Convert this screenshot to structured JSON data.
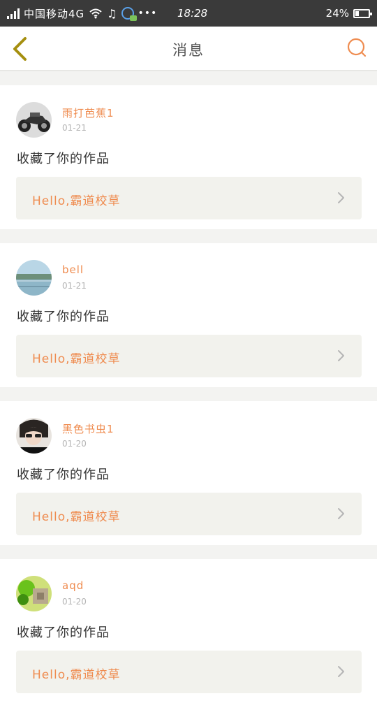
{
  "status_bar": {
    "carrier": "中国移动4G",
    "time": "18:28",
    "battery": "24%",
    "dots": "•••"
  },
  "header": {
    "title": "消息",
    "back_icon": "chevron-left-icon",
    "search_icon": "search-icon"
  },
  "colors": {
    "accent": "#ef8c50",
    "back_icon": "#a58f0f",
    "link_background": "#f2f2ed",
    "page_background": "#f3f3f1"
  },
  "messages": [
    {
      "user": "雨打芭蕉1",
      "date": "01-21",
      "text": "收藏了你的作品",
      "work": "Hello,霸道校草",
      "avatar": "motorcycle-avatar"
    },
    {
      "user": "bell",
      "date": "01-21",
      "text": "收藏了你的作品",
      "work": "Hello,霸道校草",
      "avatar": "landscape-avatar"
    },
    {
      "user": "黑色书虫1",
      "date": "01-20",
      "text": "收藏了你的作品",
      "work": "Hello,霸道校草",
      "avatar": "person-avatar"
    },
    {
      "user": "aqd",
      "date": "01-20",
      "text": "收藏了你的作品",
      "work": "Hello,霸道校草",
      "avatar": "green-object-avatar"
    }
  ]
}
